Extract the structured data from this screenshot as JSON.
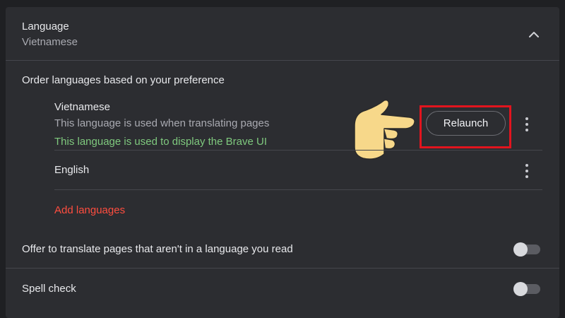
{
  "section": {
    "title": "Language",
    "subtitle": "Vietnamese"
  },
  "order_heading": "Order languages based on your preference",
  "languages": [
    {
      "name": "Vietnamese",
      "note1": "This language is used when translating pages",
      "note2": "This language is used to display the Brave UI",
      "action_label": "Relaunch"
    },
    {
      "name": "English"
    }
  ],
  "add_languages_label": "Add languages",
  "settings": {
    "offer_translate": {
      "label": "Offer to translate pages that aren't in a language you read",
      "enabled": false
    },
    "spell_check": {
      "label": "Spell check",
      "enabled": false
    }
  },
  "colors": {
    "background": "#2c2d31",
    "accent_green": "#7fc97e",
    "accent_red": "#ff4d3f",
    "highlight_box": "#e2141e",
    "hand": "#f7d88a"
  },
  "icons": {
    "collapse": "chevron-up-icon",
    "more": "more-vertical-icon",
    "pointer": "pointing-hand-icon"
  }
}
